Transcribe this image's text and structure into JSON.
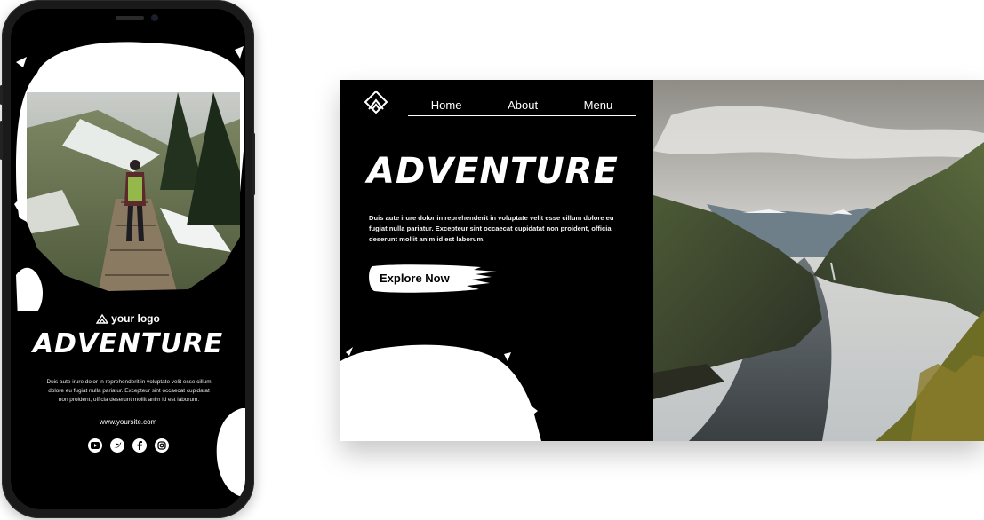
{
  "phone": {
    "logo_text": "your logo",
    "title": "ADVENTURE",
    "body": "Duis aute irure dolor in reprehenderit in voluptate velit esse cillum dolore eu fugiat nulla pariatur. Excepteur sint occaecat cupidatat non proident, officia deserunt mollit anim id est laborum.",
    "website": "www.yoursite.com",
    "social_icons": [
      "youtube-icon",
      "twitter-icon",
      "facebook-icon",
      "instagram-icon"
    ]
  },
  "desktop": {
    "nav": {
      "home": "Home",
      "about": "About",
      "menu": "Menu"
    },
    "title": "ADVENTURE",
    "body": "Duis aute irure dolor in reprehenderit in voluptate velit esse cillum dolore eu fugiat nulla pariatur. Excepteur sint occaecat cupidatat non proident, officia deserunt mollit anim id est laborum.",
    "cta_label": "Explore Now"
  },
  "colors": {
    "background": "#ffffff",
    "panel": "#000000",
    "accent": "#ffffff"
  }
}
